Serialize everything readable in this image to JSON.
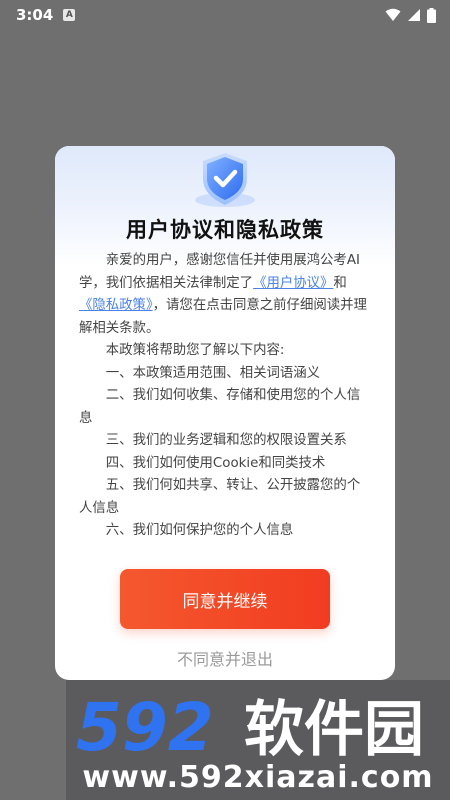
{
  "status_bar": {
    "time": "3:04",
    "notification_glyph": "A",
    "icons": [
      "wifi-icon",
      "signal-icon",
      "battery-icon"
    ]
  },
  "dialog": {
    "title": "用户协议和隐私政策",
    "intro_prefix": "亲爱的用户，感谢您信任并使用展鸿公考AI学，我们依据相关法律制定了",
    "user_agreement_link": "《用户协议》",
    "and_text": "和",
    "privacy_policy_link": "《隐私政策》",
    "intro_suffix": "，请您在点击同意之前仔细阅读并理解相关条款。",
    "policy_intro": "本政策将帮助您了解以下内容:",
    "items": [
      "一、本政策适用范围、相关词语涵义",
      "二、我们如何收集、存储和使用您的个人信息",
      "三、我们的业务逻辑和您的权限设置关系",
      "四、我们如何使用Cookie和同类技术",
      "五、我们何如共享、转让、公开披露您的个人信息",
      "六、我们如何保护您的个人信息"
    ],
    "agree_button": "同意并继续",
    "decline_link": "不同意并退出"
  },
  "watermark": {
    "logo_digits": "592",
    "logo_text": "软件园",
    "url": "www.592xiazai.com"
  },
  "colors": {
    "accent_orange": "#f23c21",
    "link_blue": "#4a82e8",
    "backdrop": "#6f6f6f"
  }
}
